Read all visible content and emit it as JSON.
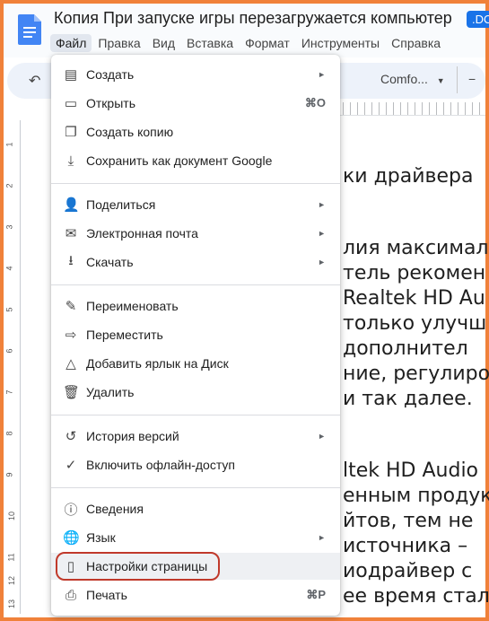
{
  "doc": {
    "title": "Копия При запуске игры перезагружается компьютер",
    "badge": ".DO"
  },
  "menubar": [
    "Файл",
    "Правка",
    "Вид",
    "Вставка",
    "Формат",
    "Инструменты",
    "Справка"
  ],
  "toolbar": {
    "font": "Comfo..."
  },
  "ruler_numbers": [
    "1",
    "2",
    "3",
    "4",
    "5",
    "6",
    "7",
    "8",
    "9",
    "10",
    "11",
    "12",
    "13"
  ],
  "content_lines": [
    "ки драйвера",
    "лия максимал",
    "тель рекомен",
    "Realtek HD Au",
    "только улучш",
    "дополнител",
    "ние, регулиро",
    "и так далее.",
    "ltek HD Audio",
    "енным продук",
    "йтов, тем не",
    "источника –",
    "иодрайвер с",
    "ее время стал"
  ],
  "file_menu": {
    "items": [
      {
        "label": "Создать",
        "icon": "new-doc-icon",
        "submenu": true
      },
      {
        "label": "Открыть",
        "icon": "folder-icon",
        "shortcut": "⌘O"
      },
      {
        "label": "Создать копию",
        "icon": "copy-icon"
      },
      {
        "label": "Сохранить как документ Google",
        "icon": "save-icon"
      },
      {
        "label": "Поделиться",
        "icon": "share-icon",
        "submenu": true
      },
      {
        "label": "Электронная почта",
        "icon": "email-icon",
        "submenu": true
      },
      {
        "label": "Скачать",
        "icon": "download-icon",
        "submenu": true
      },
      {
        "label": "Переименовать",
        "icon": "rename-icon"
      },
      {
        "label": "Переместить",
        "icon": "move-icon"
      },
      {
        "label": "Добавить ярлык на Диск",
        "icon": "drive-shortcut-icon"
      },
      {
        "label": "Удалить",
        "icon": "trash-icon"
      },
      {
        "label": "История версий",
        "icon": "history-icon",
        "submenu": true
      },
      {
        "label": "Включить офлайн-доступ",
        "icon": "offline-icon"
      },
      {
        "label": "Сведения",
        "icon": "info-icon"
      },
      {
        "label": "Язык",
        "icon": "globe-icon",
        "submenu": true
      },
      {
        "label": "Настройки страницы",
        "icon": "page-setup-icon",
        "highlighted": true
      },
      {
        "label": "Печать",
        "icon": "print-icon",
        "shortcut": "⌘P"
      }
    ]
  },
  "colors": {
    "accent": "#1a73e8",
    "highlight_circle": "#c0392b",
    "frame": "#f0813a"
  }
}
